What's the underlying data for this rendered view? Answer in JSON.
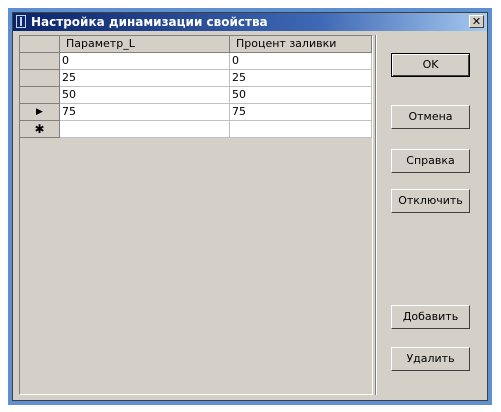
{
  "window": {
    "title": "Настройка динамизации свойства",
    "close_glyph": "✕"
  },
  "grid": {
    "columns": [
      "Параметр_L",
      "Процент заливки"
    ],
    "rows": [
      {
        "marker": "",
        "cells": [
          "0",
          "0"
        ]
      },
      {
        "marker": "",
        "cells": [
          "25",
          "25"
        ]
      },
      {
        "marker": "",
        "cells": [
          "50",
          "50"
        ]
      },
      {
        "marker": "▶",
        "cells": [
          "75",
          "75"
        ]
      }
    ],
    "new_row_marker": "✱"
  },
  "buttons": {
    "ok": "OK",
    "cancel": "Отмена",
    "help": "Справка",
    "disable": "Отключить",
    "add": "Добавить",
    "delete": "Удалить"
  }
}
